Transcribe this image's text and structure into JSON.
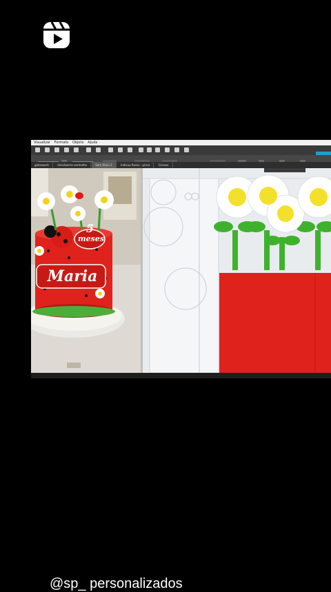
{
  "app": {
    "menu": [
      "Visualizar",
      "Formato",
      "Objeto",
      "Ajuda"
    ],
    "tabs": [
      "gatoswork",
      "divisãozero-vermelho",
      "Sem título 2",
      "Indívua Rosso - placa",
      "Girasos"
    ],
    "active_tab_index": 2
  },
  "overlay": {
    "username": "@sp_ personalizados"
  },
  "photo": {
    "cake_name": "Maria",
    "months_number": "5",
    "months_label": "meses"
  },
  "icons": {
    "reels": "reels-icon"
  },
  "colors": {
    "background": "#000000",
    "accent": "#1da1c8",
    "cake_red": "#e0221c",
    "daisy_yellow": "#f3e02a",
    "stem_green": "#3fb22d"
  }
}
